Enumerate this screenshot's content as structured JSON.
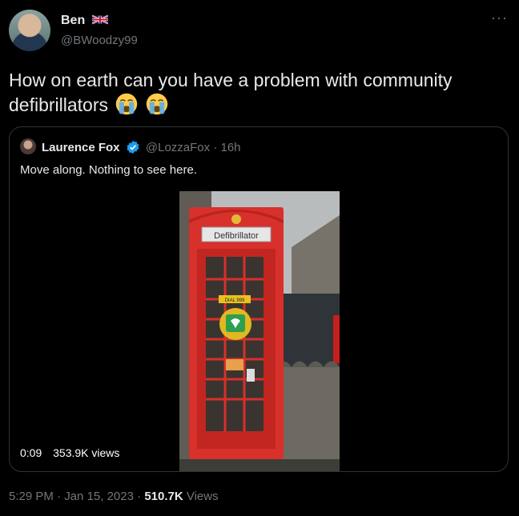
{
  "author": {
    "name": "Ben",
    "flag": "uk-flag-icon",
    "handle": "@BWoodzy99"
  },
  "tweet": {
    "text": "How on earth can you have a problem with community defibrillators",
    "emojis": [
      "loudly-crying-face-icon",
      "loudly-crying-face-icon"
    ]
  },
  "quoted": {
    "name": "Laurence Fox",
    "handle": "@LozzaFox",
    "separator": "·",
    "time": "16h",
    "text": "Move along. Nothing to see here.",
    "video": {
      "duration": "0:09",
      "views": "353.9K views",
      "sign_text": "Defibrillator",
      "box_label": "DIAL 999"
    }
  },
  "footer": {
    "time": "5:29 PM",
    "date": "Jan 15, 2023",
    "sep": "·",
    "views_count": "510.7K",
    "views_label": "Views"
  },
  "colors": {
    "verified": "#1d9bf0",
    "phonebox_red": "#d8302a",
    "muted": "#71767b"
  }
}
